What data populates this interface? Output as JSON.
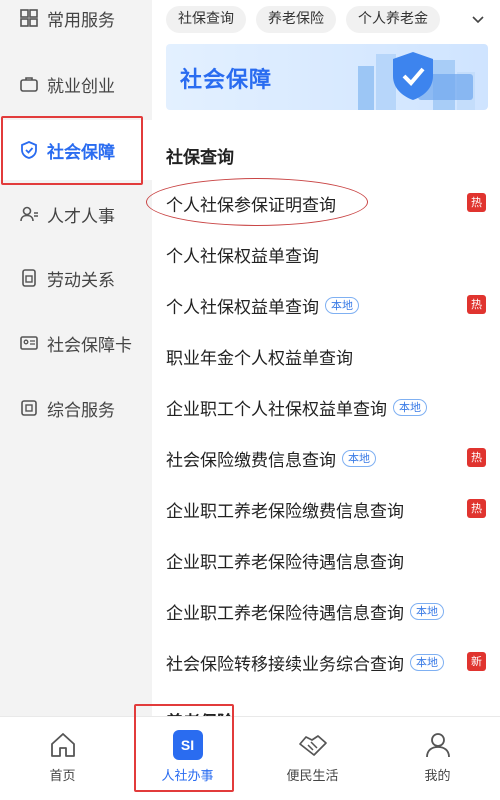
{
  "sidebar": {
    "items": [
      {
        "label": "常用服务",
        "icon": "grid-icon"
      },
      {
        "label": "就业创业",
        "icon": "briefcase-icon"
      },
      {
        "label": "社会保障",
        "icon": "shield-icon",
        "active": true
      },
      {
        "label": "人才人事",
        "icon": "person-card-icon"
      },
      {
        "label": "劳动关系",
        "icon": "document-icon"
      },
      {
        "label": "社会保障卡",
        "icon": "id-card-icon"
      },
      {
        "label": "综合服务",
        "icon": "service-icon"
      }
    ]
  },
  "chips": [
    "社保查询",
    "养老保险",
    "个人养老金"
  ],
  "banner": {
    "title": "社会保障"
  },
  "section": {
    "title": "社保查询",
    "next_title_cut": "养老保险"
  },
  "list": [
    {
      "label": "个人社保参保证明查询",
      "local": "",
      "badge": "热"
    },
    {
      "label": "个人社保权益单查询",
      "local": "",
      "badge": ""
    },
    {
      "label": "个人社保权益单查询",
      "local": "本地",
      "badge": "热"
    },
    {
      "label": "职业年金个人权益单查询",
      "local": "",
      "badge": ""
    },
    {
      "label": "企业职工个人社保权益单查询",
      "local": "本地",
      "badge": ""
    },
    {
      "label": "社会保险缴费信息查询",
      "local": "本地",
      "badge": "热"
    },
    {
      "label": "企业职工养老保险缴费信息查询",
      "local": "",
      "badge": "热"
    },
    {
      "label": "企业职工养老保险待遇信息查询",
      "local": "",
      "badge": ""
    },
    {
      "label": "企业职工养老保险待遇信息查询",
      "local": "本地",
      "badge": ""
    },
    {
      "label": "社会保险转移接续业务综合查询",
      "local": "本地",
      "badge": "新"
    }
  ],
  "bottom_nav": [
    {
      "label": "首页",
      "icon": "home-icon"
    },
    {
      "label": "人社办事",
      "icon": "si-icon",
      "badge_text": "SI",
      "active": true
    },
    {
      "label": "便民生活",
      "icon": "handshake-icon"
    },
    {
      "label": "我的",
      "icon": "user-icon"
    }
  ],
  "colors": {
    "accent": "#2a6cf0",
    "hot": "#e0342f",
    "annotation": "#e23b3b"
  }
}
